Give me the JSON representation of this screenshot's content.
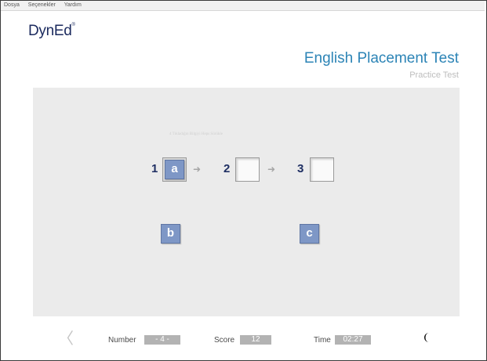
{
  "menu": [
    "Dosya",
    "Seçenekler",
    "Yardım"
  ],
  "brand": {
    "name": "DynEd",
    "mark": "®"
  },
  "header": {
    "title": "English Placement Test",
    "subtitle": "Practice Test"
  },
  "exercise": {
    "faint_text": "4  Tıkladığın Bilgiyi Heps Sürükle",
    "slots": [
      {
        "number": "1",
        "value": "a"
      },
      {
        "number": "2",
        "value": ""
      },
      {
        "number": "3",
        "value": ""
      }
    ],
    "arrow": "➜",
    "tiles": [
      "b",
      "c"
    ]
  },
  "footer": {
    "back_icon": "chevron-left-icon",
    "back_glyph": "〈",
    "number_label": "Number",
    "number_value": "- 4 -",
    "score_label": "Score",
    "score_value": "12",
    "time_label": "Time",
    "time_value": "02:27",
    "moon_icon": "moon-icon"
  },
  "colors": {
    "title": "#2c84b6",
    "tile": "#7e97c6",
    "brand": "#1b2a5e"
  }
}
